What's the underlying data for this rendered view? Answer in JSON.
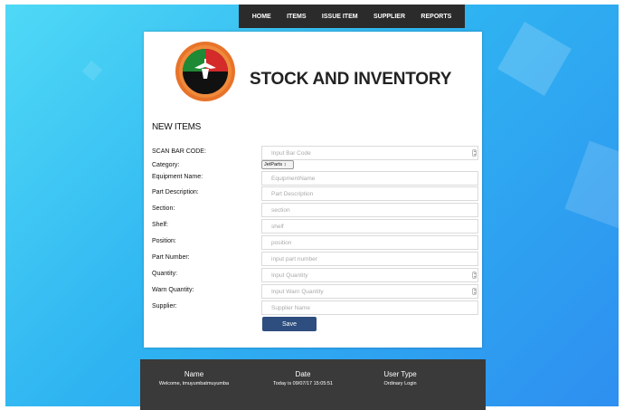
{
  "nav": {
    "items": [
      "HOME",
      "ITEMS",
      "ISSUE ITEM",
      "SUPPLIER",
      "REPORTS"
    ]
  },
  "brand": {
    "title": "STOCK AND INVENTORY"
  },
  "form": {
    "title": "NEW ITEMS",
    "rows": [
      {
        "label": "SCAN BAR CODE:",
        "placeholder": "Input Bar Code"
      },
      {
        "label": "Category:",
        "select_value": "JetParts"
      },
      {
        "label": "Equipment Name:",
        "placeholder": "EquipmentName"
      },
      {
        "label": "Part Description:",
        "placeholder": "Part Description"
      },
      {
        "label": "Section:",
        "placeholder": "section"
      },
      {
        "label": "Shelf:",
        "placeholder": "shelf"
      },
      {
        "label": "Position:",
        "placeholder": "position"
      },
      {
        "label": "Part Number:",
        "placeholder": "input part number"
      },
      {
        "label": "Quantity:",
        "placeholder": "Input Quantity"
      },
      {
        "label": "Warn Quantity:",
        "placeholder": "Input Warn Quantity"
      },
      {
        "label": "Supplier:",
        "placeholder": "Supplier Name"
      }
    ],
    "save_label": "Save"
  },
  "footer": {
    "name_header": "Name",
    "name_value": "Welcome, tmuyumbatmuyumba",
    "date_header": "Date",
    "date_value": "Today is 09/07/17 15:05:51",
    "usertype_header": "User Type",
    "usertype_value": "Ordinary Login"
  },
  "colors": {
    "background_gradient_start": "#4fd9f6",
    "background_gradient_end": "#2e8ff0",
    "nav_bg": "#2b2b2b",
    "button_bg": "#2d4e7e",
    "footer_bg": "#3a3a3a"
  }
}
